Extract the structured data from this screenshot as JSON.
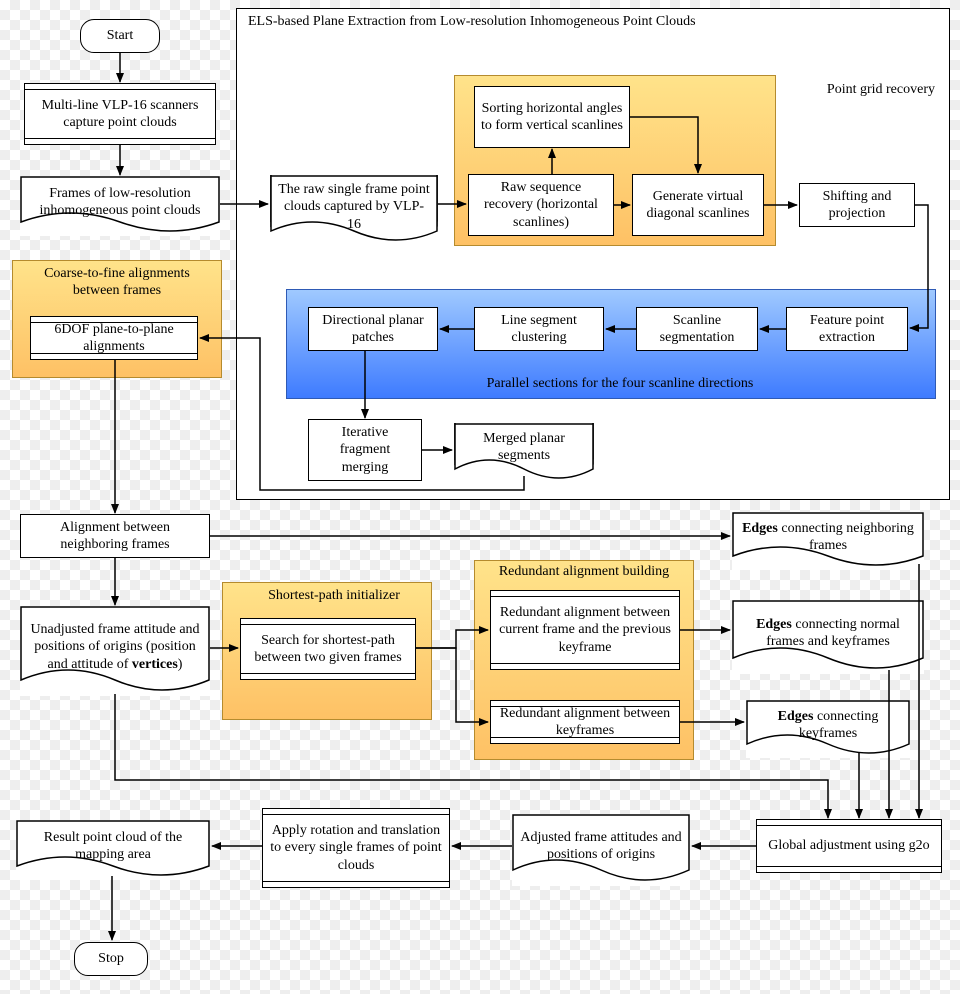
{
  "start": "Start",
  "stop": "Stop",
  "capture": "Multi-line VLP-16 scanners capture point clouds",
  "frames_low_res": "Frames of low-resolution inhomogeneous point clouds",
  "els_title": "ELS-based Plane Extraction from Low-resolution Inhomogeneous Point Clouds",
  "raw_single": "The raw single frame point clouds captured by VLP-16",
  "point_grid_recovery": "Point grid recovery",
  "sorting": "Sorting horizontal angles to form vertical scanlines",
  "raw_seq": "Raw sequence recovery (horizontal scanlines)",
  "gen_virtual": "Generate virtual diagonal scanlines",
  "shifting": "Shifting and projection",
  "parallel_caption": "Parallel sections for the four scanline directions",
  "feature_point": "Feature point extraction",
  "scanline_seg": "Scanline segmentation",
  "line_cluster": "Line segment clustering",
  "dir_planar": "Directional planar patches",
  "iter_merge": "Iterative fragment merging",
  "merged_planar": "Merged planar segments",
  "coarse_fine_title": "Coarse-to-fine alignments between frames",
  "six_dof": "6DOF plane-to-plane alignments",
  "align_neighbor": "Alignment between neighboring frames",
  "unadjusted_pre": "Unadjusted frame attitude and positions of origins (position and attitude of ",
  "unadjusted_bold": "vertices",
  "unadjusted_post": ")",
  "shortest_title": "Shortest-path initializer",
  "shortest_search": "Search for shortest-path between two given frames",
  "redundant_title": "Redundant alignment building",
  "redundant_prev": "Redundant alignment between current frame and the previous keyframe",
  "redundant_key": "Redundant alignment between keyframes",
  "edges_neighbor_pre": "Edges",
  "edges_neighbor_post": " connecting neighboring frames",
  "edges_normal_pre": "Edges",
  "edges_normal_post": " connecting normal frames and keyframes",
  "edges_key_pre": "Edges",
  "edges_key_post": " connecting keyframes",
  "global_adj": "Global adjustment using g2o",
  "adjusted_frame": "Adjusted frame attitudes and positions of origins",
  "apply_rot": "Apply rotation and translation to every single frames of point clouds",
  "result_cloud": "Result point cloud of the mapping area"
}
